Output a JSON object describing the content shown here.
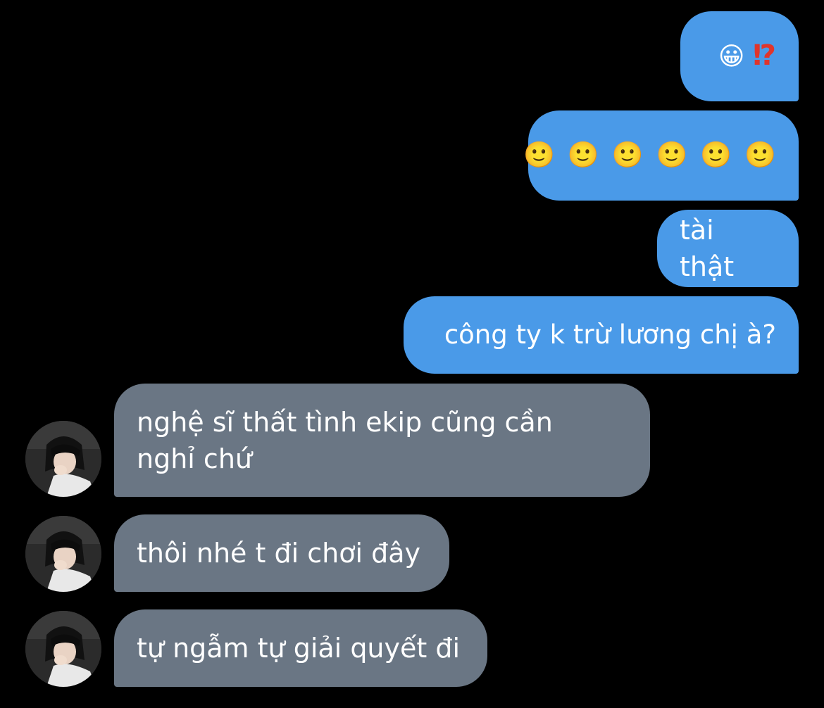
{
  "messages": {
    "out": [
      {
        "id": "m1",
        "text": "😀 ⁉️"
      },
      {
        "id": "m2",
        "emojis": [
          "🙂",
          "🙂",
          "🙂",
          "🙂",
          "🙂",
          "🙂"
        ]
      },
      {
        "id": "m3",
        "text": "tài thật"
      },
      {
        "id": "m4",
        "text": "công ty k trừ lương chị à?"
      }
    ],
    "in": [
      {
        "id": "m5",
        "lines": [
          "nghệ sĩ thất tình ekip cũng cần",
          "nghỉ chứ"
        ]
      },
      {
        "id": "m6",
        "text": "thôi nhé t đi chơi đây"
      },
      {
        "id": "m7",
        "text": "tự ngẫm tự giải quyết đi"
      }
    ]
  },
  "icons": {
    "avatar": "contact-avatar-icon"
  },
  "colors": {
    "background": "#000000",
    "outgoing_bubble": "#4a9ae8",
    "incoming_bubble": "#6a7684",
    "text": "#ffffff"
  }
}
